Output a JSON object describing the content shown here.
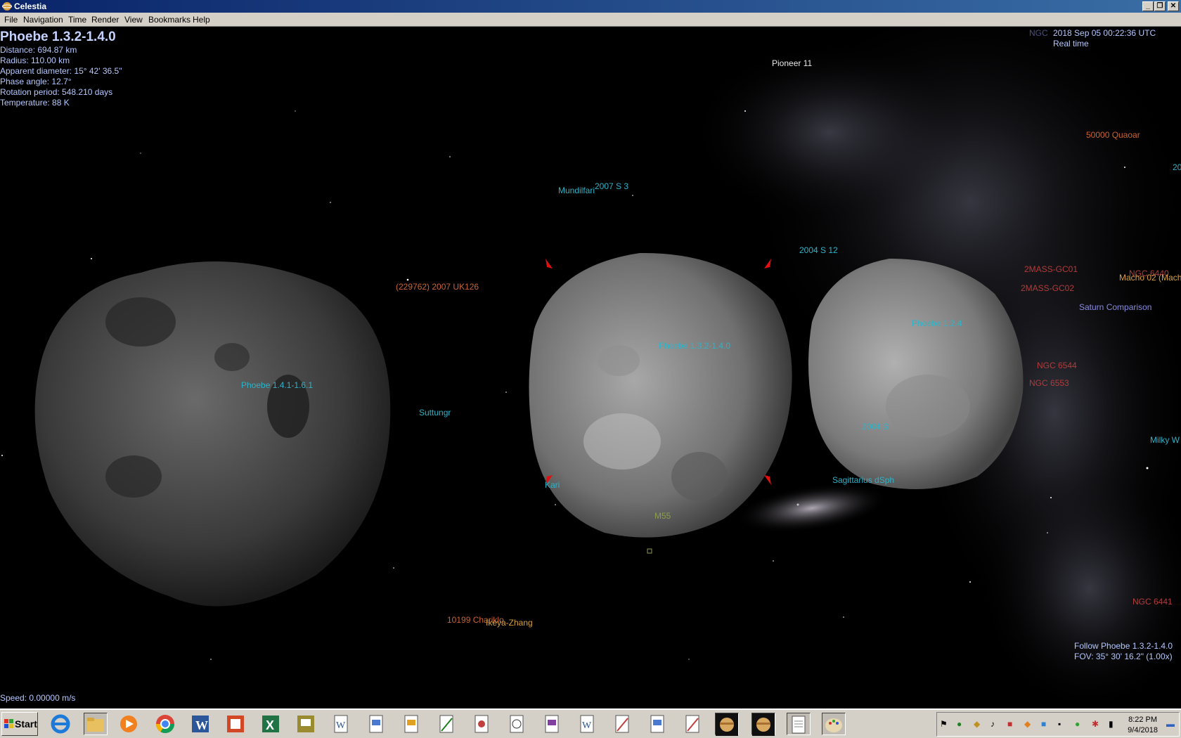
{
  "window": {
    "title": "Celestia",
    "minimize": "_",
    "restore": "❐",
    "close": "✕"
  },
  "menu": [
    "File",
    "Navigation",
    "Time",
    "Render",
    "View",
    "Bookmarks",
    "Help"
  ],
  "hud": {
    "object_name": "Phoebe 1.3.2-1.4.0",
    "distance": "Distance: 694.87 km",
    "radius": "Radius: 110.00 km",
    "apparent_diameter": "Apparent diameter: 15° 42' 36.5\"",
    "phase_angle": "Phase angle: 12.7°",
    "rotation_period": "Rotation period: 548.210 days",
    "temperature": "Temperature: 88 K",
    "datetime": "2018 Sep 05 00:22:36 UTC",
    "time_mode": "Real time",
    "ngc_hint": "NGC",
    "speed": "Speed: 0.00000 m/s",
    "follow": "Follow Phoebe 1.3.2-1.4.0",
    "fov": "FOV: 35° 30' 16.2\" (1.00x)"
  },
  "labels": {
    "pioneer": "Pioneer 11",
    "quaoar": "50000 Quaoar",
    "edge_20": "20",
    "mundilfari": "Mundilfari",
    "s2007_3": "2007 S 3",
    "s2004_12": "2004 S 12",
    "uk126": "(229762) 2007 UK126",
    "phoebe_left": "Phoebe 1.4.1-1.6.1",
    "phoebe_mid": "Phoebe 1.3.2-1.4.0",
    "phoebe_right": "Phoebe 1.2.4",
    "suttungr": "Suttungr",
    "s2004_lower": "2004 S",
    "kari": "Kari",
    "sagittarius": "Sagittarius dSph",
    "m55": "M55",
    "chariklo": "10199 Chariklo",
    "ikeya": "Ikeya-Zhang",
    "gc01": "2MASS-GC01",
    "gc02": "2MASS-GC02",
    "ngc6440": "NGC 6440",
    "macho": "Macho 02 (Macho",
    "saturn_comp": "Saturn Comparison",
    "ngc6544": "NGC 6544",
    "ngc6553": "NGC 6553",
    "milky": "Milky W",
    "ngc6441": "NGC 6441"
  },
  "taskbar": {
    "start": "Start",
    "apps": [
      "internet-explorer",
      "file-explorer",
      "media-player",
      "chrome",
      "word",
      "powerpoint",
      "excel",
      "publisher",
      "document",
      "document",
      "document",
      "document",
      "document",
      "document",
      "document",
      "document",
      "document",
      "document",
      "document",
      "document",
      "celestia",
      "celestia",
      "notepad",
      "paint"
    ],
    "clock_time": "8:22 PM",
    "clock_date": "9/4/2018"
  },
  "colors": {
    "hud_text": "#b4c8ff",
    "moon_label": "#2fb3c8",
    "minor_planet_label": "#c86432",
    "nebula_label": "#b03c3c"
  }
}
